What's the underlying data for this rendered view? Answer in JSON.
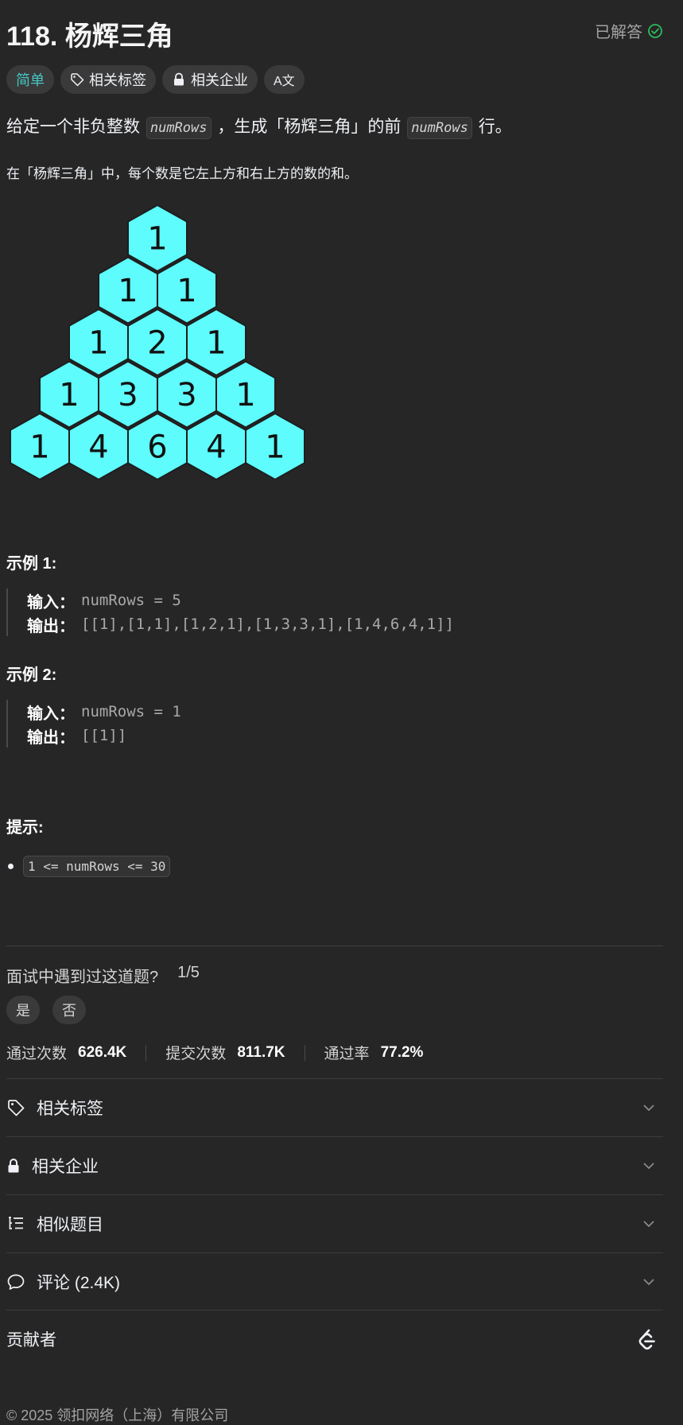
{
  "header": {
    "title": "118. 杨辉三角",
    "status": "已解答",
    "accent_color": "#2cbb5d"
  },
  "tags": [
    {
      "label": "简单",
      "icon": ""
    },
    {
      "label": "相关标签",
      "icon": "tag-icon"
    },
    {
      "label": "相关企业",
      "icon": "lock-icon"
    },
    {
      "label": "",
      "icon": "translate-icon"
    }
  ],
  "translate_glyph": "A文",
  "description": {
    "line1_a": "给定一个非负整数",
    "line1_code1": "numRows",
    "line1_b": "，生成「杨辉三角」的前",
    "line1_code2": "numRows",
    "line1_c": "行。",
    "line2": "在「杨辉三角」中，每个数是它左上方和右上方的数的和。"
  },
  "pyramid": {
    "rows": [
      [
        "1"
      ],
      [
        "1",
        "1"
      ],
      [
        "1",
        "2",
        "1"
      ],
      [
        "1",
        "3",
        "3",
        "1"
      ],
      [
        "1",
        "4",
        "6",
        "4",
        "1"
      ]
    ],
    "fill_color": "#5efcfc"
  },
  "examples": [
    {
      "title": "示例 1:",
      "input_label": "输入：",
      "input": "numRows = 5",
      "output_label": "输出：",
      "output": "[[1],[1,1],[1,2,1],[1,3,3,1],[1,4,6,4,1]]"
    },
    {
      "title": "示例 2:",
      "input_label": "输入：",
      "input": "numRows = 1",
      "output_label": "输出：",
      "output": "[[1]]"
    }
  ],
  "hints": {
    "title": "提示:",
    "items": [
      "1 <= numRows <= 30"
    ]
  },
  "interview": {
    "question": "面试中遇到过这道题?",
    "count": "1/5",
    "yes": "是",
    "no": "否"
  },
  "stats": [
    {
      "label": "通过次数",
      "value": "626.4K"
    },
    {
      "label": "提交次数",
      "value": "811.7K"
    },
    {
      "label": "通过率",
      "value": "77.2%"
    }
  ],
  "accordion": [
    {
      "label": "相关标签",
      "icon": "tag-icon"
    },
    {
      "label": "相关企业",
      "icon": "lock-icon"
    },
    {
      "label": "相似题目",
      "icon": "list-icon"
    },
    {
      "label": "评论 (2.4K)",
      "icon": "comment-icon"
    }
  ],
  "contributors": {
    "label": "贡献者",
    "icon": "leetcode-logo-icon"
  },
  "footer": "© 2025 领扣网络（上海）有限公司"
}
